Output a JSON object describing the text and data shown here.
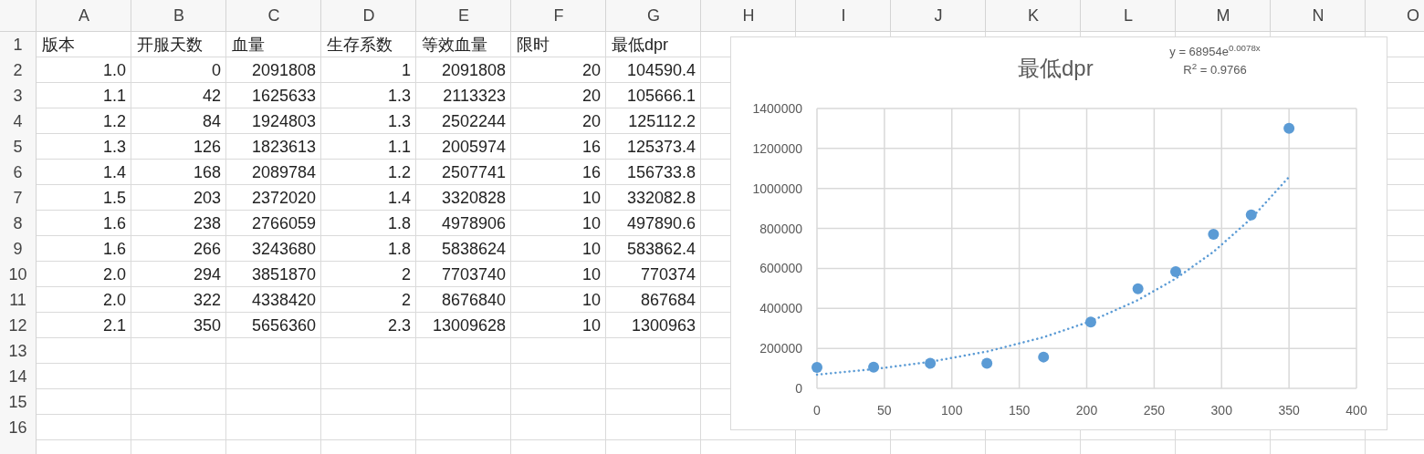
{
  "sheet": {
    "columns": [
      "A",
      "B",
      "C",
      "D",
      "E",
      "F",
      "G",
      "H",
      "I",
      "J",
      "K",
      "L",
      "M",
      "N",
      "O"
    ],
    "rows": [
      {
        "number": "1",
        "kind": "text",
        "cells": [
          "版本",
          "开服天数",
          "血量",
          "生存系数",
          "等效血量",
          "限时",
          "最低dpr"
        ]
      },
      {
        "number": "2",
        "kind": "number",
        "cells": [
          "1.0",
          "0",
          "2091808",
          "1",
          "2091808",
          "20",
          "104590.4"
        ]
      },
      {
        "number": "3",
        "kind": "number",
        "cells": [
          "1.1",
          "42",
          "1625633",
          "1.3",
          "2113323",
          "20",
          "105666.1"
        ]
      },
      {
        "number": "4",
        "kind": "number",
        "cells": [
          "1.2",
          "84",
          "1924803",
          "1.3",
          "2502244",
          "20",
          "125112.2"
        ]
      },
      {
        "number": "5",
        "kind": "number",
        "cells": [
          "1.3",
          "126",
          "1823613",
          "1.1",
          "2005974",
          "16",
          "125373.4"
        ]
      },
      {
        "number": "6",
        "kind": "number",
        "cells": [
          "1.4",
          "168",
          "2089784",
          "1.2",
          "2507741",
          "16",
          "156733.8"
        ]
      },
      {
        "number": "7",
        "kind": "number",
        "cells": [
          "1.5",
          "203",
          "2372020",
          "1.4",
          "3320828",
          "10",
          "332082.8"
        ]
      },
      {
        "number": "8",
        "kind": "number",
        "cells": [
          "1.6",
          "238",
          "2766059",
          "1.8",
          "4978906",
          "10",
          "497890.6"
        ]
      },
      {
        "number": "9",
        "kind": "number",
        "cells": [
          "1.6",
          "266",
          "3243680",
          "1.8",
          "5838624",
          "10",
          "583862.4"
        ]
      },
      {
        "number": "10",
        "kind": "number",
        "cells": [
          "2.0",
          "294",
          "3851870",
          "2",
          "7703740",
          "10",
          "770374"
        ]
      },
      {
        "number": "11",
        "kind": "number",
        "cells": [
          "2.0",
          "322",
          "4338420",
          "2",
          "8676840",
          "10",
          "867684"
        ]
      },
      {
        "number": "12",
        "kind": "number",
        "cells": [
          "2.1",
          "350",
          "5656360",
          "2.3",
          "13009628",
          "10",
          "1300963"
        ]
      },
      {
        "number": "13",
        "kind": "number",
        "cells": []
      },
      {
        "number": "14",
        "kind": "number",
        "cells": []
      },
      {
        "number": "15",
        "kind": "number",
        "cells": []
      },
      {
        "number": "16",
        "kind": "number",
        "cells": []
      }
    ]
  },
  "chart": {
    "chart_data": {
      "type": "scatter",
      "title": "最低dpr",
      "x": [
        0,
        42,
        84,
        126,
        168,
        203,
        238,
        266,
        294,
        322,
        350
      ],
      "grid": true,
      "series": [
        {
          "color": "#5b9bd5",
          "values": [
            104590.4,
            105666.1,
            125112.2,
            125373.4,
            156733.8,
            332082.8,
            497890.6,
            583862.4,
            770374,
            867684,
            1300963
          ]
        },
        {
          "type": "line",
          "line_style": "dotted",
          "color": "#5b9bd5",
          "values": [
            68954,
            95680,
            132780,
            184240,
            255670,
            335890,
            441380,
            549080,
            683130,
            849930,
            1057290
          ]
        }
      ],
      "xlim": [
        0,
        400
      ],
      "ylim": [
        0,
        1400000
      ],
      "xticks": [
        0,
        50,
        100,
        150,
        200,
        250,
        300,
        350,
        400
      ],
      "yticks": [
        0,
        200000,
        400000,
        600000,
        800000,
        1000000,
        1200000,
        1400000
      ],
      "annotations": [
        "y = 68954e$^{0.0078x}$",
        "R$^{2}$ = 0.9766"
      ]
    }
  }
}
